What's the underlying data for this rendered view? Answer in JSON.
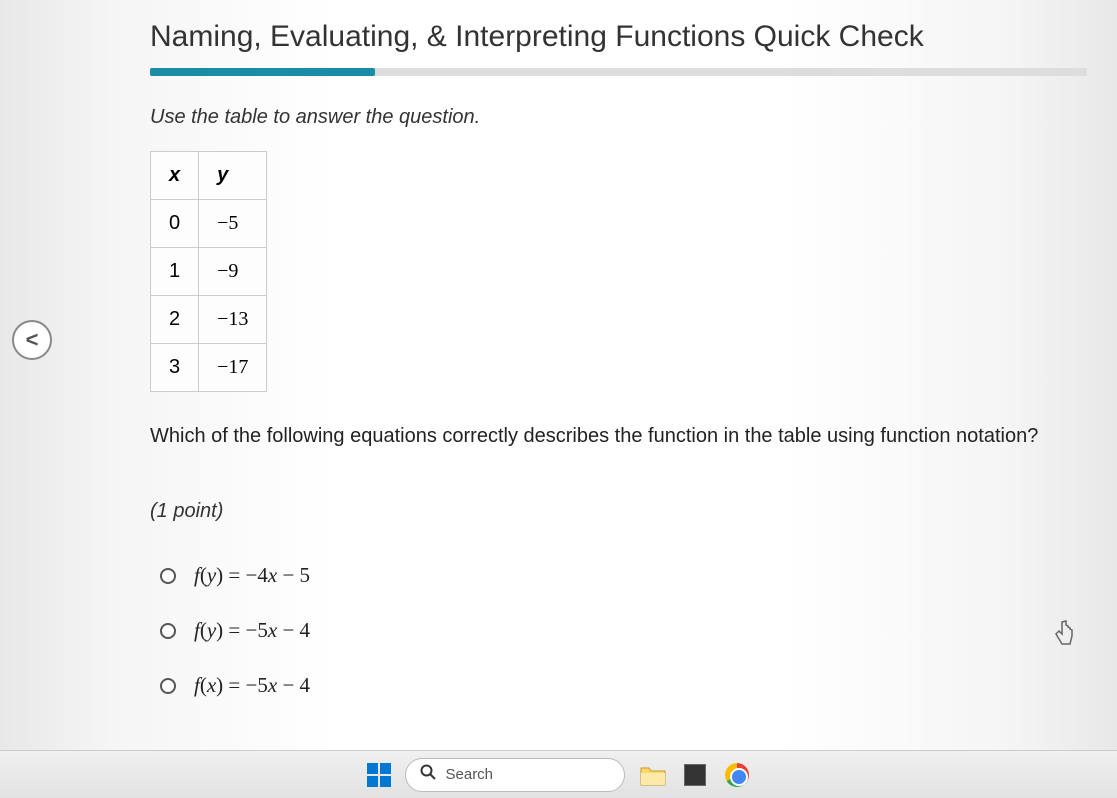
{
  "title": "Naming, Evaluating, & Interpreting Functions Quick Check",
  "instruction": "Use the table to answer the question.",
  "table": {
    "headers": [
      "x",
      "y"
    ],
    "rows": [
      [
        "0",
        "−5"
      ],
      [
        "1",
        "−9"
      ],
      [
        "2",
        "−13"
      ],
      [
        "3",
        "−17"
      ]
    ]
  },
  "question": "Which of the following equations correctly describes the function in the table using function notation?",
  "points": "(1 point)",
  "options": [
    "f(y) = −4x − 5",
    "f(y) = −5x − 4",
    "f(x) = −5x − 4"
  ],
  "nav_prev": "<",
  "taskbar": {
    "search_placeholder": "Search"
  }
}
